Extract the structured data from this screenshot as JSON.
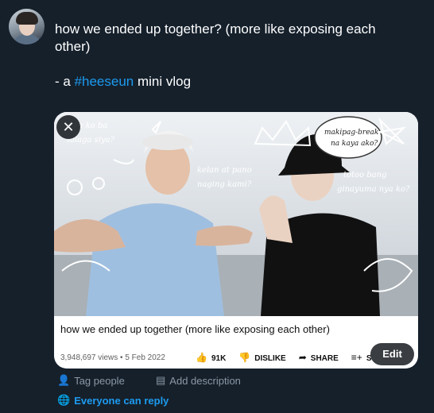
{
  "tweet": {
    "line1": "how we ended up together? (more like exposing each",
    "line2": "other)",
    "prefix": "- a ",
    "hashtag": "#heeseun",
    "suffix": " mini vlog"
  },
  "media": {
    "close_icon": "✕",
    "overlay_text": {
      "t1": "sino ba",
      "t1b": "wa ko ba",
      "t2": "talaga siya?",
      "t3": "kelan at pano",
      "t4": "naging kami?",
      "t5": "makipag-break",
      "t6": "na kaya ako?",
      "t7": "totoo bang",
      "t8": "ginayuma nya ko?"
    },
    "video_title": "how we ended up together (more like exposing each other)",
    "views": "3,948,697 views • 5 Feb 2022",
    "likes": "91K",
    "dislike": "DISLIKE",
    "share": "SHARE",
    "save": "S",
    "edit_label": "Edit"
  },
  "actions": {
    "tag_people": "Tag people",
    "add_description": "Add description",
    "everyone_reply": "Everyone can reply"
  },
  "colors": {
    "background": "#15202b",
    "accent": "#1d9bf0",
    "muted": "#8b98a5"
  }
}
